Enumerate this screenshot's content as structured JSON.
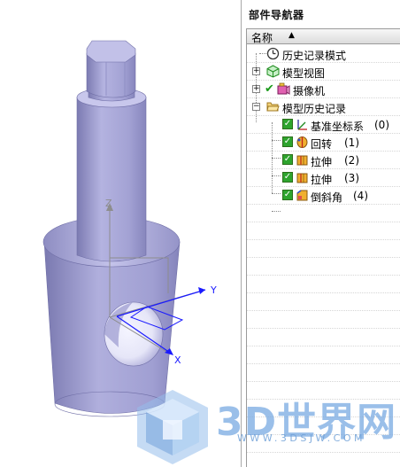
{
  "navigator": {
    "title": "部件导航器",
    "column_name": "名称",
    "sort_icon": "sort-ascending-icon",
    "items": [
      {
        "label": "历史记录模式",
        "icon": "clock-icon"
      },
      {
        "label": "模型视图",
        "icon": "model-view-icon",
        "expander": "+"
      },
      {
        "label": "摄像机",
        "icon": "camera-icon",
        "expander": "+"
      },
      {
        "label": "模型历史记录",
        "icon": "folder-open-icon",
        "expander": "−"
      },
      {
        "label": "基准坐标系",
        "suffix": "(0)",
        "icon": "datum-csys-icon",
        "checked": true
      },
      {
        "label": "回转",
        "suffix": "(1)",
        "icon": "revolve-icon",
        "checked": true
      },
      {
        "label": "拉伸",
        "suffix": "(2)",
        "icon": "extrude-icon",
        "checked": true
      },
      {
        "label": "拉伸",
        "suffix": "(3)",
        "icon": "extrude-icon",
        "checked": true
      },
      {
        "label": "倒斜角",
        "suffix": "(4)",
        "icon": "chamfer-icon",
        "checked": true
      }
    ]
  },
  "viewport": {
    "axis_z": "Z",
    "axis_y": "Y",
    "axis_x": "X"
  },
  "watermark": {
    "brand": "3D世界网",
    "url": "WWW.3DSJW.COM"
  },
  "colors": {
    "part_fill": "#a9a8d6",
    "part_light": "#c9c8ec",
    "part_dark": "#7f7eb4",
    "axis": "#1a1aff",
    "check": "#2ea42e"
  }
}
